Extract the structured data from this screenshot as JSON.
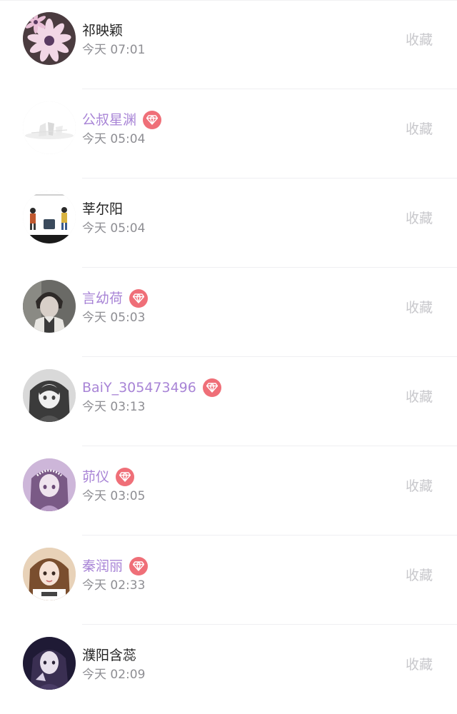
{
  "follow_list": {
    "items": [
      {
        "name": "祁映颖",
        "time": "今天 07:01",
        "vip": false,
        "action_label": "收藏",
        "avatar_icon": "pink-daisy-photo-icon"
      },
      {
        "name": "公叔星渊",
        "time": "今天 05:04",
        "vip": true,
        "action_label": "收藏",
        "avatar_icon": "faded-sketch-photo-icon"
      },
      {
        "name": "莘尔阳",
        "time": "今天 05:04",
        "vip": false,
        "action_label": "收藏",
        "avatar_icon": "travelers-illustration-icon"
      },
      {
        "name": "言幼荷",
        "time": "今天 05:03",
        "vip": true,
        "action_label": "收藏",
        "avatar_icon": "boy-portrait-photo-icon"
      },
      {
        "name": "BaiY_305473496",
        "time": "今天 03:13",
        "vip": true,
        "action_label": "收藏",
        "avatar_icon": "anime-girl-gray-icon"
      },
      {
        "name": "茆仪",
        "time": "今天 03:05",
        "vip": true,
        "action_label": "收藏",
        "avatar_icon": "anime-girl-purple-icon"
      },
      {
        "name": "秦润丽",
        "time": "今天 02:33",
        "vip": true,
        "action_label": "收藏",
        "avatar_icon": "girl-selfie-photo-icon"
      },
      {
        "name": "濮阳含蕊",
        "time": "今天 02:09",
        "vip": false,
        "action_label": "收藏",
        "avatar_icon": "dark-portrait-photo-icon"
      }
    ]
  },
  "colors": {
    "vip_name": "#a884d6",
    "normal_name": "#222222",
    "time": "#8e8e93",
    "action": "#c8c8cc",
    "vip_badge": "#ef6f78"
  }
}
